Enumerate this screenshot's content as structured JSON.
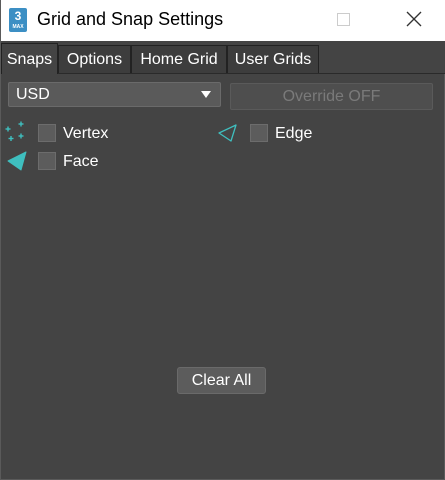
{
  "window": {
    "title": "Grid and Snap Settings",
    "app_icon_number": "3",
    "app_icon_sub": "MAX"
  },
  "tabs": [
    {
      "label": "Snaps",
      "active": true
    },
    {
      "label": "Options",
      "active": false
    },
    {
      "label": "Home Grid",
      "active": false
    },
    {
      "label": "User Grids",
      "active": false
    }
  ],
  "snaps": {
    "dropdown_value": "USD",
    "override_label": "Override OFF",
    "items": [
      {
        "label": "Vertex",
        "checked": false,
        "icon": "vertex-icon"
      },
      {
        "label": "Edge",
        "checked": false,
        "icon": "edge-icon"
      },
      {
        "label": "Face",
        "checked": false,
        "icon": "face-icon"
      }
    ],
    "clear_all_label": "Clear All"
  },
  "colors": {
    "accent": "#3fbfbf",
    "panel_bg": "#444444",
    "titlebar_bg": "#ffffff"
  }
}
